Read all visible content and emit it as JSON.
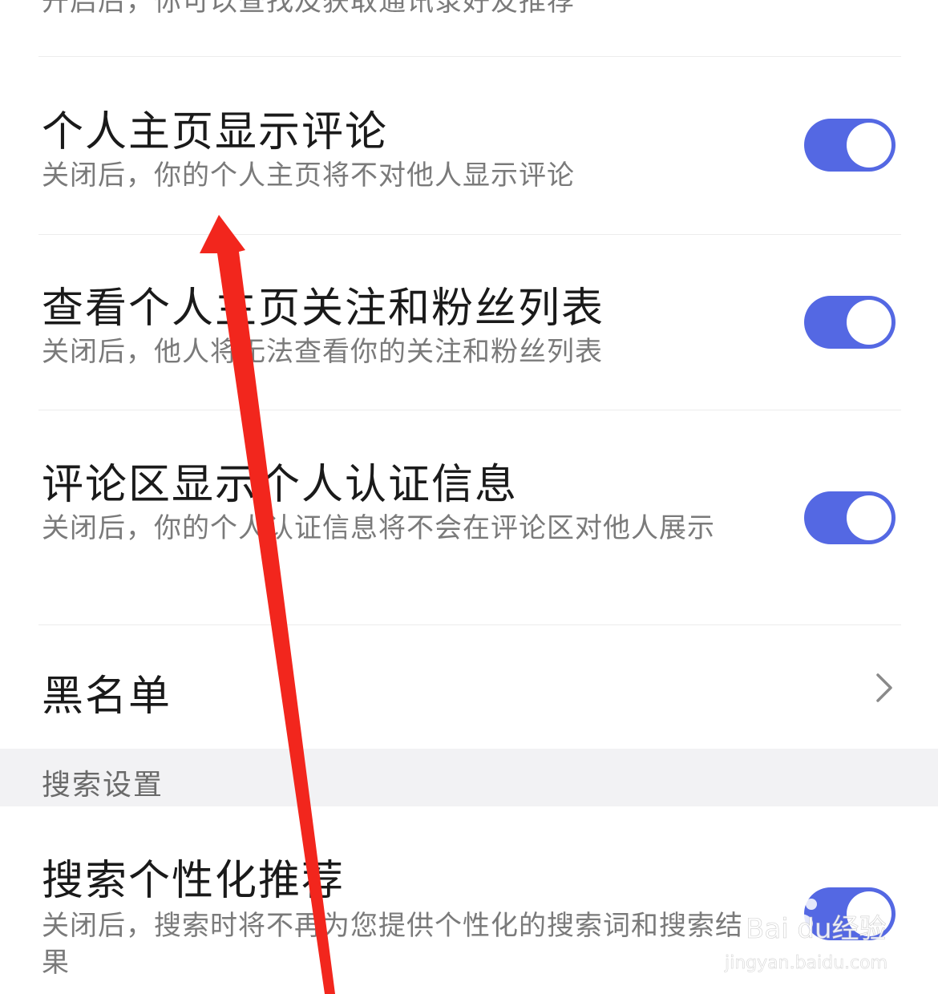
{
  "top_item": {
    "desc": "开启后，你可以查找及获取通讯录好友推荐"
  },
  "items": [
    {
      "title": "个人主页显示评论",
      "desc": "关闭后，你的个人主页将不对他人显示评论",
      "enabled": true
    },
    {
      "title": "查看个人主页关注和粉丝列表",
      "desc": "关闭后，他人将无法查看你的关注和粉丝列表",
      "enabled": true
    },
    {
      "title": "评论区显示个人认证信息",
      "desc": "关闭后，你的个人认证信息将不会在评论区对他人展示",
      "enabled": true
    }
  ],
  "blacklist": {
    "label": "黑名单",
    "icon": "chevron-right-icon"
  },
  "search_section": {
    "header": "搜索设置",
    "item": {
      "title": "搜索个性化推荐",
      "desc": "关闭后，搜索时将不再为您提供个性化的搜索词和搜索结果",
      "enabled": true
    }
  },
  "watermark": {
    "brand": "Bai du经验",
    "url": "jingyan.baidu.com"
  },
  "colors": {
    "toggle_on": "#5468e3",
    "annotation_arrow": "#f2261d",
    "section_bg": "#f2f2f4"
  }
}
